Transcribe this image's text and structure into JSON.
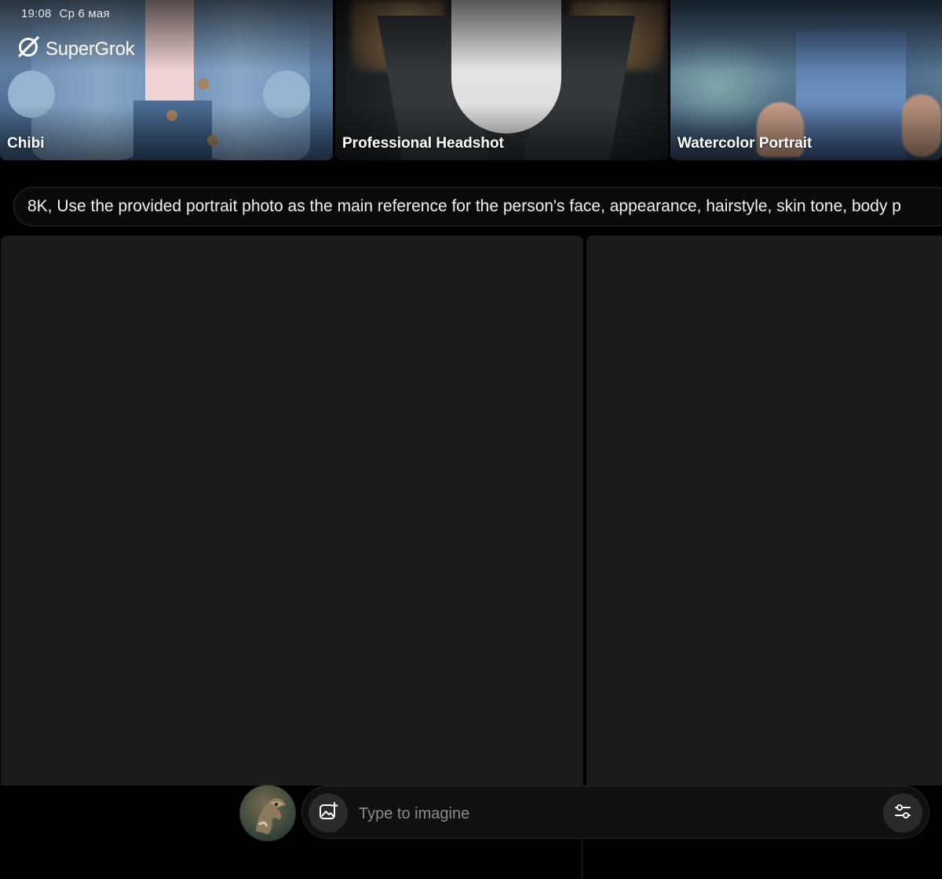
{
  "status_bar": {
    "time": "19:08",
    "date": "Ср 6 мая"
  },
  "brand": {
    "name": "SuperGrok",
    "icon": "grok-logo-icon"
  },
  "styles": [
    {
      "label": "Chibi"
    },
    {
      "label": "Professional Headshot"
    },
    {
      "label": "Watercolor Portrait"
    }
  ],
  "prompt": {
    "text": "8K, Use the provided portrait photo as the main reference for the person's face, appearance, hairstyle, skin tone, body p"
  },
  "composer": {
    "placeholder": "Type to imagine",
    "value": "",
    "add_image_icon": "image-plus-icon",
    "settings_icon": "sliders-icon"
  },
  "colors": {
    "background": "#000000",
    "panel": "#1b1b1b",
    "composer_bg": "#101010",
    "button_bg": "#2a2a2a",
    "text": "#ffffff",
    "placeholder": "#8c8c8c"
  }
}
